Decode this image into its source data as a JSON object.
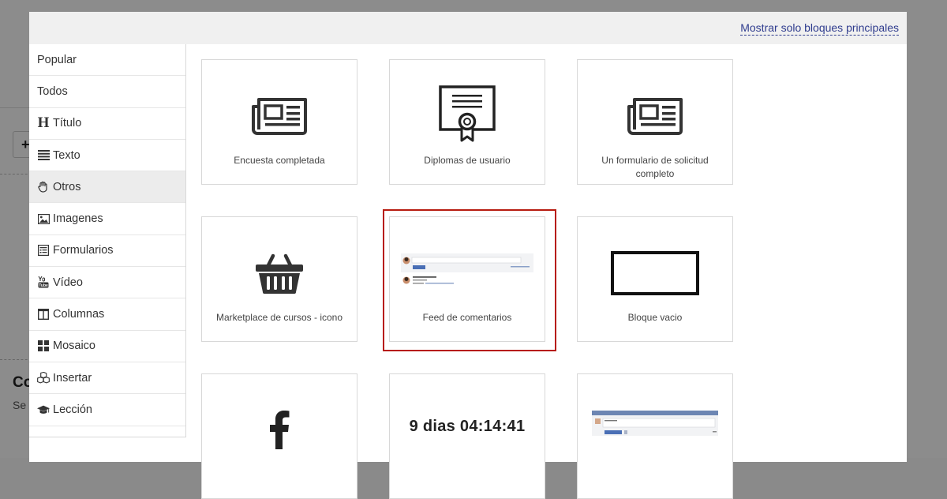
{
  "modal": {
    "top_link": "Mostrar solo bloques principales"
  },
  "sidebar": {
    "items": [
      {
        "label": "Popular",
        "icon": "none"
      },
      {
        "label": "Todos",
        "icon": "none"
      },
      {
        "label": "Título",
        "icon": "heading-icon"
      },
      {
        "label": "Texto",
        "icon": "text-lines-icon"
      },
      {
        "label": "Otros",
        "icon": "hand-icon"
      },
      {
        "label": "Imagenes",
        "icon": "image-icon"
      },
      {
        "label": "Formularios",
        "icon": "form-icon"
      },
      {
        "label": "Vídeo",
        "icon": "youtube-icon"
      },
      {
        "label": "Columnas",
        "icon": "columns-icon"
      },
      {
        "label": "Mosaico",
        "icon": "mosaic-icon"
      },
      {
        "label": "Insertar",
        "icon": "cubes-icon"
      },
      {
        "label": "Lección",
        "icon": "graduation-cap-icon"
      }
    ],
    "active": "Otros",
    "heading_glyph": "H"
  },
  "blocks": [
    {
      "label": "Encuesta completada",
      "icon": "newspaper-icon"
    },
    {
      "label": "Diplomas de usuario",
      "icon": "certificate-icon"
    },
    {
      "label": "Un formulario de solicitud completo",
      "icon": "newspaper-icon"
    },
    {
      "label": "Marketplace de cursos - icono",
      "icon": "basket-icon"
    },
    {
      "label": "Feed de comentarios",
      "icon": "comment-feed-preview",
      "highlighted": true
    },
    {
      "label": "Bloque vacio",
      "icon": "empty-rectangle-icon"
    },
    {
      "label": "",
      "icon": "facebook-icon"
    },
    {
      "label": "",
      "icon": "countdown",
      "countdown": "9 dias 04:14:41"
    },
    {
      "label": "",
      "icon": "comment-widget-preview"
    }
  ],
  "background_page": {
    "heading_fragment": "Co",
    "sub_fragment": "Se",
    "button_glyph": "+"
  },
  "colors": {
    "highlight": "#b71c10",
    "link": "#2f3c8e",
    "preview_accent": "#4a6fb5"
  }
}
